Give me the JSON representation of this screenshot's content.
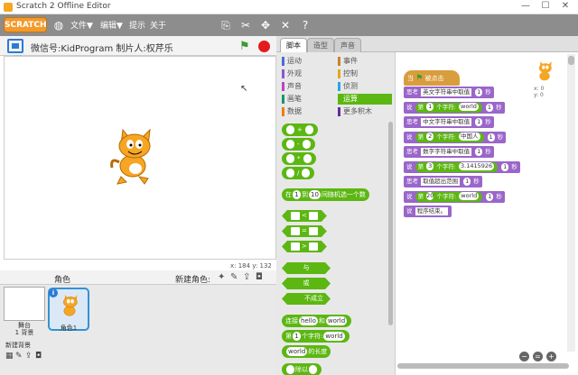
{
  "window": {
    "title": "Scratch 2 Offline Editor",
    "controls": [
      "—",
      "☐",
      "✕"
    ]
  },
  "menubar": {
    "logo": "SCRATCH",
    "globe_icon": "globe-icon",
    "file": "文件▼",
    "edit": "编辑▼",
    "tips": "提示",
    "about": "关于",
    "tools": [
      "copy-icon",
      "cut-icon",
      "grow-icon",
      "shrink-icon",
      "help-icon"
    ]
  },
  "stage": {
    "project_title": "微信号:KidProgram  制片人:权芹乐",
    "version": "v461",
    "coords": "x: 184   y: 132"
  },
  "sprites": {
    "header": "角色",
    "new_sprite": "新建角色:",
    "stage_label": "舞台",
    "stage_backdrops": "1 背景",
    "new_backdrop": "新建背景",
    "sprite_name": "角色1"
  },
  "tabs": [
    "脚本",
    "造型",
    "声音"
  ],
  "categories": {
    "left": [
      {
        "label": "运动",
        "color": "#4a6cd4"
      },
      {
        "label": "外观",
        "color": "#8a55d7"
      },
      {
        "label": "声音",
        "color": "#bb42c3"
      },
      {
        "label": "画笔",
        "color": "#0e9a6c"
      },
      {
        "label": "数据",
        "color": "#ee7d16"
      }
    ],
    "right": [
      {
        "label": "事件",
        "color": "#c88330"
      },
      {
        "label": "控制",
        "color": "#e1a91a"
      },
      {
        "label": "侦测",
        "color": "#2ca5e2"
      },
      {
        "label": "运算",
        "color": "#5cb712"
      },
      {
        "label": "更多积木",
        "color": "#632d99"
      }
    ]
  },
  "palette": {
    "ops": [
      "+",
      "-",
      "*",
      "/"
    ],
    "random": {
      "pre": "在",
      "a": "1",
      "mid": "到",
      "b": "10",
      "post": "间随机选一个数"
    },
    "compare": [
      "<",
      "=",
      ">"
    ],
    "bool": [
      "与",
      "或",
      "不成立"
    ],
    "join": {
      "pre": "连接",
      "a": "hello",
      "mid": "和",
      "b": "world"
    },
    "letter": {
      "pre": "第",
      "n": "1",
      "mid": "个字符:",
      "s": "world"
    },
    "length": {
      "s": "world",
      "post": "的长度"
    },
    "mod": {
      "post": "除以"
    }
  },
  "scripts": {
    "hat": {
      "pre": "当",
      "post": "被点击"
    },
    "lines": [
      {
        "kind": "think",
        "verb": "思考",
        "text": "英文字符串中取值",
        "secs": "1",
        "unit": "秒"
      },
      {
        "kind": "say_letter",
        "verb": "说",
        "pre": "第",
        "n": "1",
        "mid": "个字符:",
        "s": "world",
        "secs": "1",
        "unit": "秒"
      },
      {
        "kind": "think",
        "verb": "思考",
        "text": "中文字符串中取值",
        "secs": "1",
        "unit": "秒"
      },
      {
        "kind": "say_letter",
        "verb": "说",
        "pre": "第",
        "n": "2",
        "mid": "个字符:",
        "s": "中国人",
        "secs": "1",
        "unit": "秒"
      },
      {
        "kind": "think",
        "verb": "思考",
        "text": "数字字符串中取值",
        "secs": "1",
        "unit": "秒"
      },
      {
        "kind": "say_letter",
        "verb": "说",
        "pre": "第",
        "n": "3",
        "mid": "个字符:",
        "s": "3.1415926",
        "secs": "1",
        "unit": "秒"
      },
      {
        "kind": "think",
        "verb": "思考",
        "text": "取值超出范围",
        "secs": "1",
        "unit": "秒"
      },
      {
        "kind": "say_letter",
        "verb": "说",
        "pre": "第",
        "n": "20",
        "mid": "个字符:",
        "s": "world",
        "secs": "1",
        "unit": "秒"
      },
      {
        "kind": "say",
        "verb": "说",
        "text": "程序结束。"
      }
    ]
  },
  "sprite_info": {
    "x": "x: 0",
    "y": "y: 0"
  },
  "zoom": [
    "−",
    "=",
    "+"
  ]
}
